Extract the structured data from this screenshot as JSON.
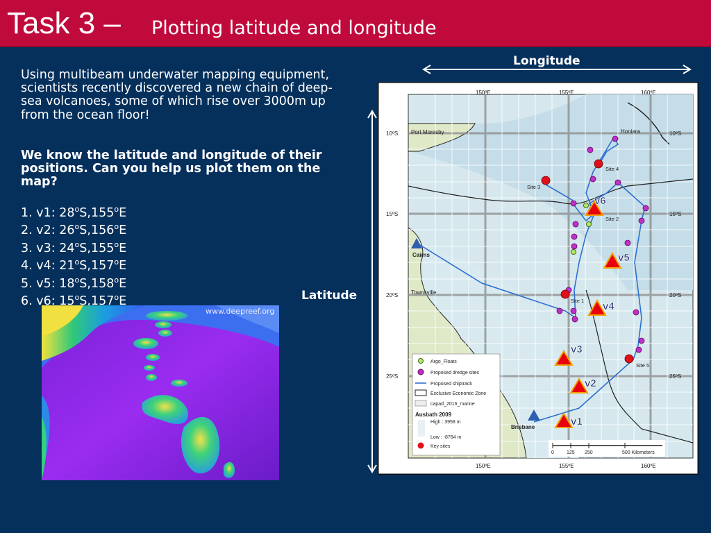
{
  "header": {
    "task": "Task 3 –",
    "subtitle": "Plotting latitude and longitude"
  },
  "intro_text": "Using multibeam underwater mapping equipment, scientists recently discovered a new chain of deep-sea volcanoes, some of which rise over 3000m up from the ocean floor!",
  "ask_text": "We know the latitude and longitude of their positions. Can you help us plot them on the map?",
  "volcanoes": [
    {
      "n": "1.",
      "name": "v1",
      "lat": "28",
      "lon": "155"
    },
    {
      "n": "2.",
      "name": "v2",
      "lat": "26",
      "lon": "156"
    },
    {
      "n": "3.",
      "name": "v3",
      "lat": "24",
      "lon": "155"
    },
    {
      "n": "4.",
      "name": "v4",
      "lat": "21",
      "lon": "157"
    },
    {
      "n": "5.",
      "name": "v5",
      "lat": "18",
      "lon": "158"
    },
    {
      "n": "6.",
      "name": "v6",
      "lat": "15",
      "lon": "157"
    }
  ],
  "degree_mark": "o",
  "hemisphere_s": "S,",
  "hemisphere_e": "E",
  "photo_watermark": "www.deepreef.org",
  "axis_labels": {
    "longitude": "Longitude",
    "latitude": "Latitude"
  },
  "map": {
    "lon_ticks": [
      "150ºE",
      "155ºE",
      "160ºE"
    ],
    "lat_ticks": [
      "10ºS",
      "15ºS",
      "20ºS",
      "25ºS"
    ],
    "places": [
      "Port Moresby",
      "Honiara",
      "Cairns",
      "Townsville",
      "Brisbane"
    ],
    "sites": [
      "Site 1",
      "Site 2",
      "Site 3",
      "Site 4",
      "Site 5"
    ],
    "volcano_labels": [
      "v1",
      "v2",
      "v3",
      "v4",
      "v5",
      "v6"
    ],
    "legend": {
      "items": [
        "Argo_Floats",
        "Proposed dredge sites",
        "Proposed shiptrack",
        "Exclusive Economic Zone",
        "capad_2016_marine"
      ],
      "ausbath_title": "Ausbath 2009",
      "high": "High : 3958 m",
      "low": "Low : -8764 m",
      "key_sites": "Key sites"
    },
    "scale": [
      "0",
      "125",
      "250",
      "500 Kilometers"
    ]
  },
  "colors": {
    "title_bar": "#c00a3c",
    "background": "#06305c",
    "volcano_marker": "#e8000e",
    "dredge_site": "#c12fc8",
    "shiptrack": "#2e6fd0"
  }
}
